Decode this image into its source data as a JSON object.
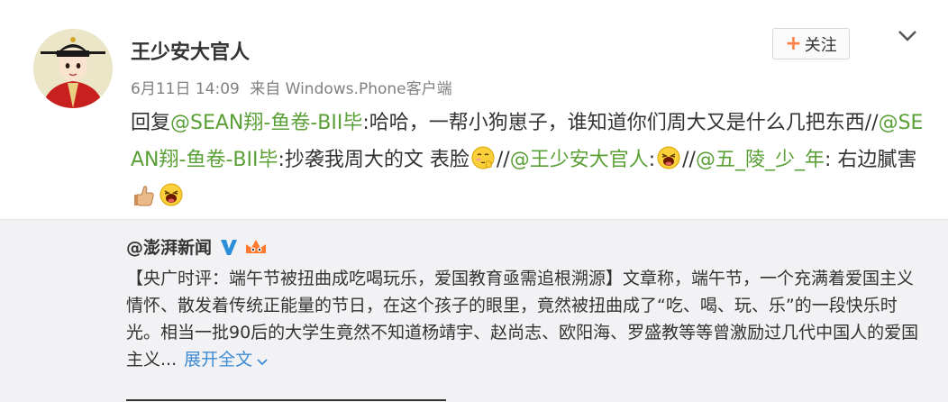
{
  "post": {
    "author": "王少安大官人",
    "follow_label": "关注",
    "date": "6月11日 14:09",
    "source": "来自 Windows.Phone客户端",
    "segments": {
      "s1": "回复",
      "m1": "@SEAN翔-鱼卷-BII毕",
      "s2": ":哈哈，一帮小狗崽子，谁知道你们周大又是什么几把东西//",
      "m2": "@SEAN翔-鱼卷-BII毕",
      "s3": ":抄袭我周大的文 表脸",
      "s4": "//",
      "m3": "@王少安大官人",
      "s5": ":",
      "s6": "//",
      "m4": "@五_陵_少_年",
      "s7": ": 右边膩害"
    }
  },
  "repost": {
    "author": "@澎湃新闻",
    "text": "【央广时评：端午节被扭曲成吃喝玩乐，爱国教育亟需追根溯源】文章称，端午节，一个充满着爱国主义情怀、散发着传统正能量的节日，在这个孩子的眼里，竟然被扭曲成了“吃、喝、玩、乐”的一段快乐时光。相当一批90后的大学生竟然不知道杨靖宇、赵尚志、欧阳海、罗盛教等等曾激励过几代中国人的爱国主义...",
    "expand_label": "展开全文"
  },
  "colors": {
    "mention": "#5aa037",
    "link": "#3d8bd3",
    "follow_plus": "#ff8140",
    "repost_bg": "#f2f2f5",
    "meta": "#808080"
  },
  "icons": [
    "avatar-image",
    "chevron-down-icon",
    "plus-icon",
    "shy-emoji",
    "laugh-emoji",
    "thumbs-up-emoji",
    "verified-v-icon",
    "vip-badge-icon",
    "expand-chevron-icon"
  ]
}
